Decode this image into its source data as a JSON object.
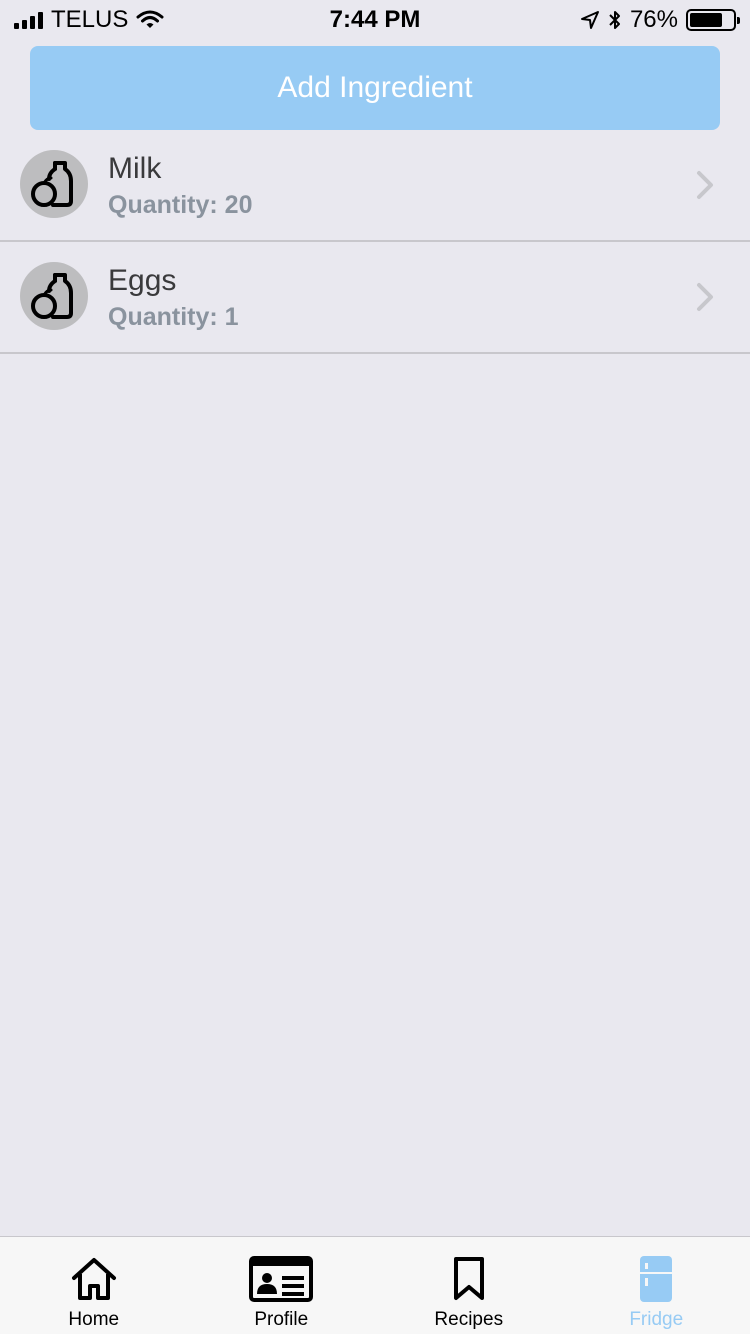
{
  "status_bar": {
    "carrier": "TELUS",
    "time": "7:44 PM",
    "battery_percent": "76%",
    "battery_level": 0.76
  },
  "add_button": {
    "label": "Add Ingredient"
  },
  "ingredients": [
    {
      "name": "Milk",
      "quantity": "Quantity: 20",
      "icon": "milk-bottle-icon"
    },
    {
      "name": "Eggs",
      "quantity": "Quantity: 1",
      "icon": "milk-bottle-icon"
    }
  ],
  "tab_bar": {
    "tabs": [
      {
        "label": "Home",
        "icon": "home-icon",
        "active": false
      },
      {
        "label": "Profile",
        "icon": "id-card-icon",
        "active": false
      },
      {
        "label": "Recipes",
        "icon": "bookmark-icon",
        "active": false
      },
      {
        "label": "Fridge",
        "icon": "fridge-icon",
        "active": true
      }
    ]
  },
  "colors": {
    "accent": "#97cbf4",
    "background": "#e9e8ef",
    "secondary_text": "#8a939e"
  }
}
